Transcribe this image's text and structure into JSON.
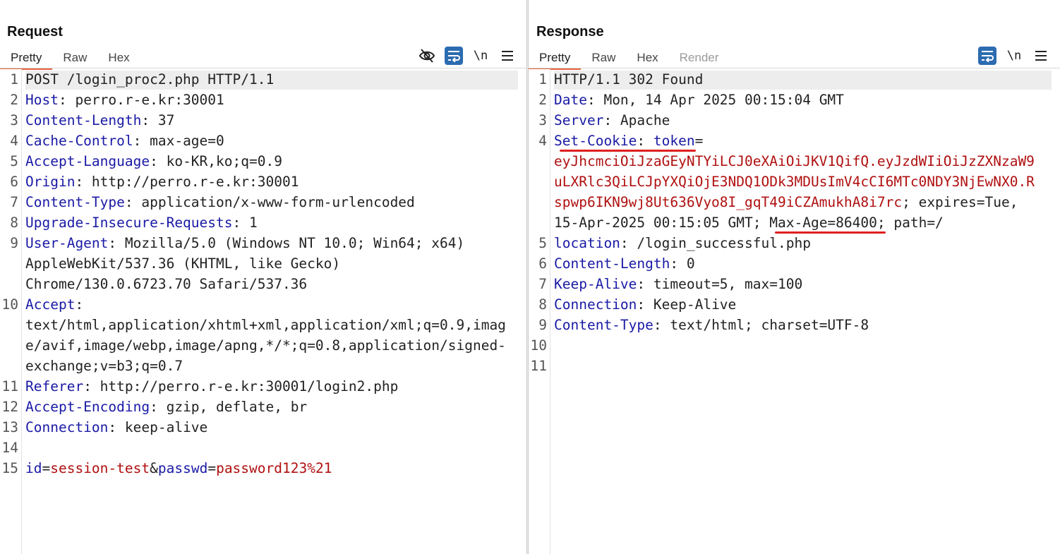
{
  "layout_switch": {
    "modes": [
      "side-by-side",
      "stacked",
      "single"
    ],
    "active": 0
  },
  "request": {
    "title": "Request",
    "tabs": [
      "Pretty",
      "Raw",
      "Hex"
    ],
    "active_tab": "Pretty",
    "tools": {
      "newline_label": "\\n"
    },
    "lines": [
      {
        "n": "1",
        "a": "POST /login_proc2.php HTTP/1.1"
      },
      {
        "n": "2",
        "k": "Host",
        "v": ": perro.r-e.kr:30001"
      },
      {
        "n": "3",
        "k": "Content-Length",
        "v": ": 37"
      },
      {
        "n": "4",
        "k": "Cache-Control",
        "v": ": max-age=0"
      },
      {
        "n": "5",
        "k": "Accept-Language",
        "v": ": ko-KR,ko;q=0.9"
      },
      {
        "n": "6",
        "k": "Origin",
        "v": ": http://perro.r-e.kr:30001"
      },
      {
        "n": "7",
        "k": "Content-Type",
        "v": ": application/x-www-form-urlencoded"
      },
      {
        "n": "8",
        "k": "Upgrade-Insecure-Requests",
        "v": ": 1"
      },
      {
        "n": "9",
        "k": "User-Agent",
        "v": ": Mozilla/5.0 (Windows NT 10.0; Win64; x64)"
      },
      {
        "n": "",
        "a": "AppleWebKit/537.36 (KHTML, like Gecko)"
      },
      {
        "n": "",
        "a": "Chrome/130.0.6723.70 Safari/537.36"
      },
      {
        "n": "10",
        "k": "Accept",
        "v": ":"
      },
      {
        "n": "",
        "a": "text/html,application/xhtml+xml,application/xml;q=0.9,imag"
      },
      {
        "n": "",
        "a": "e/avif,image/webp,image/apng,*/*;q=0.8,application/signed-"
      },
      {
        "n": "",
        "a": "exchange;v=b3;q=0.7"
      },
      {
        "n": "11",
        "k": "Referer",
        "v": ": http://perro.r-e.kr:30001/login2.php"
      },
      {
        "n": "12",
        "k": "Accept-Encoding",
        "v": ": gzip, deflate, br"
      },
      {
        "n": "13",
        "k": "Connection",
        "v": ": keep-alive"
      },
      {
        "n": "14",
        "a": ""
      }
    ],
    "body_line": {
      "n": "15",
      "id_key": "id",
      "eq1": "=",
      "id_val": "session-test",
      "amp": "&",
      "pw_key": "passwd",
      "eq2": "=",
      "pw_val": "password123%21"
    }
  },
  "response": {
    "title": "Response",
    "tabs": [
      "Pretty",
      "Raw",
      "Hex",
      "Render"
    ],
    "active_tab": "Pretty",
    "tools": {
      "newline_label": "\\n"
    },
    "lines": [
      {
        "n": "1",
        "a": "HTTP/1.1 302 Found"
      },
      {
        "n": "2",
        "k": "Date",
        "v": ": Mon, 14 Apr 2025 00:15:04 GMT"
      },
      {
        "n": "3",
        "k": "Server",
        "v": ": Apache"
      }
    ],
    "cookie": {
      "n": "4",
      "key": "Set-Cookie",
      "sep": ": ",
      "name": "token",
      "eq": "=",
      "wrap1": "eyJhcmciOiJzaGEyNTYiLCJ0eXAiOiJKV1QifQ.eyJzdWIiOiJzZXNzaW9",
      "wrap2": "uLXRlc3QiLCJpYXQiOjE3NDQ1ODk3MDUsImV4cCI6MTc0NDY3NjEwNX0.R",
      "wrap3_red": "spwp6IKN9wj8Ut636Vyo8I_gqT49iCZAmukhA8i7rc",
      "wrap3_rest": "; expires=Tue,",
      "wrap4_a": "15-Apr-2025 00:15:05 GMT; ",
      "wrap4_maxage": "Max-Age=86400",
      "wrap4_b": "; path=/"
    },
    "lines_after": [
      {
        "n": "5",
        "k": "location",
        "v": ": /login_successful.php"
      },
      {
        "n": "6",
        "k": "Content-Length",
        "v": ": 0"
      },
      {
        "n": "7",
        "k": "Keep-Alive",
        "v": ": timeout=5, max=100"
      },
      {
        "n": "8",
        "k": "Connection",
        "v": ": Keep-Alive"
      },
      {
        "n": "9",
        "k": "Content-Type",
        "v": ": text/html; charset=UTF-8"
      },
      {
        "n": "10",
        "a": ""
      },
      {
        "n": "11",
        "a": ""
      }
    ]
  },
  "colors": {
    "accent": "#2c6cb0",
    "tab_underline": "#e8643c",
    "header_key": "#1a1aa6",
    "value_red": "#b01010",
    "annotation": "#e02020"
  }
}
